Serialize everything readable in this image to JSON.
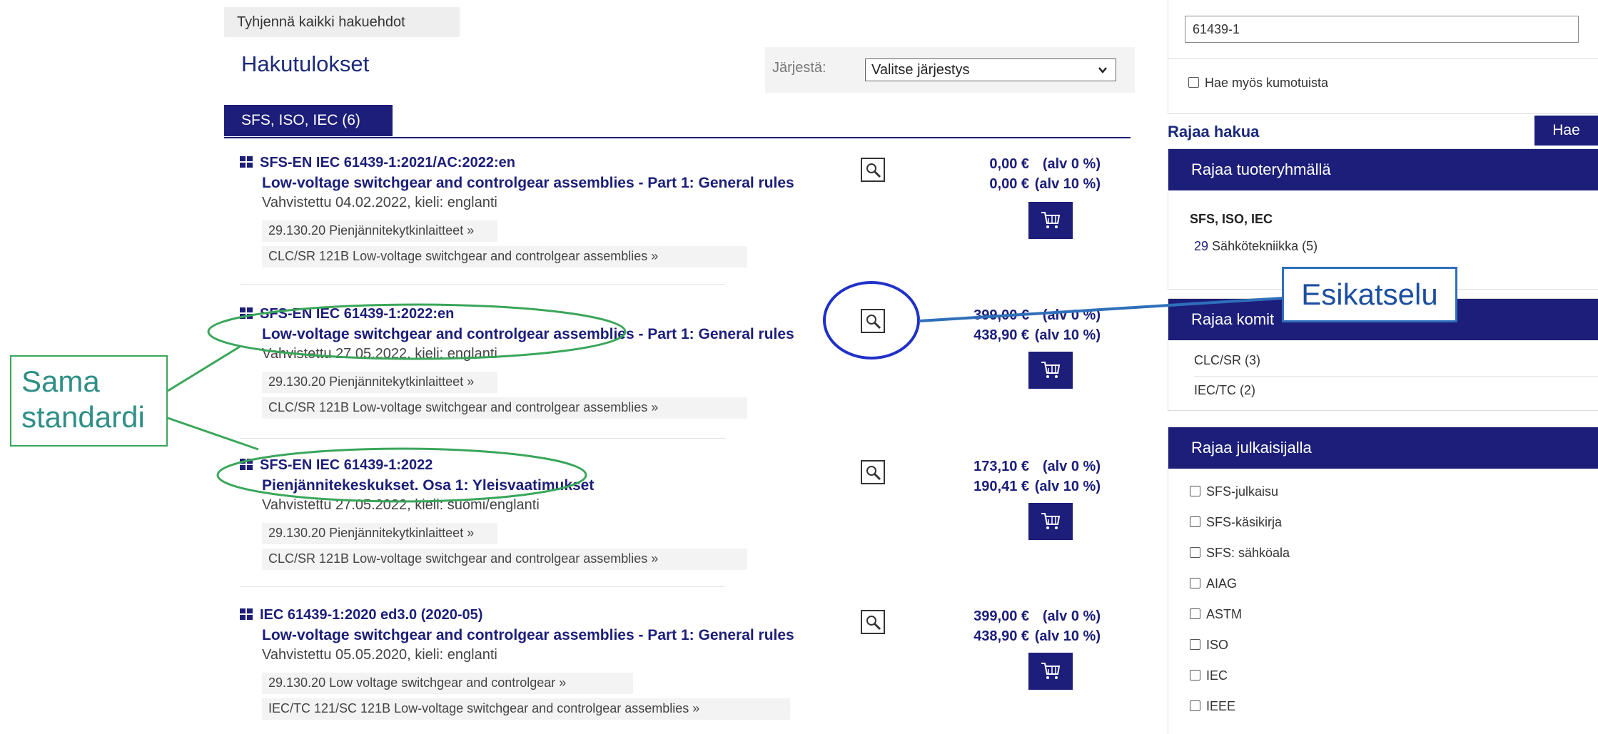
{
  "toolbar": {
    "clear_label": "Tyhjennä kaikki hakuehdot"
  },
  "header": {
    "title": "Hakutulokset",
    "sort_label": "Järjestä:",
    "sort_value": "Valitse järjestys"
  },
  "tabs": [
    {
      "label": "SFS, ISO, IEC (6)"
    }
  ],
  "results": [
    {
      "code": "SFS-EN IEC 61439-1:2021/AC:2022:en",
      "title": "Low-voltage switchgear and controlgear assemblies - Part 1: General rules",
      "date": "Vahvistettu 04.02.2022, kieli: englanti",
      "cat1": "29.130.20 Pienjännitekytkinlaitteet »",
      "cat2": "CLC/SR 121B Low-voltage switchgear and controlgear assemblies »",
      "price1": "0,00 €",
      "vat1": "(alv 0 %)",
      "price2": "0,00 €",
      "vat2": "(alv 10 %)"
    },
    {
      "code": "SFS-EN IEC 61439-1:2022:en",
      "title": "Low-voltage switchgear and controlgear assemblies - Part 1: General rules",
      "date": "Vahvistettu 27.05.2022, kieli: englanti",
      "cat1": "29.130.20 Pienjännitekytkinlaitteet »",
      "cat2": "CLC/SR 121B Low-voltage switchgear and controlgear assemblies »",
      "price1": "399,00 €",
      "vat1": "(alv 0 %)",
      "price2": "438,90 €",
      "vat2": "(alv 10 %)"
    },
    {
      "code": "SFS-EN IEC 61439-1:2022",
      "title": "Pienjännitekeskukset. Osa 1: Yleisvaatimukset",
      "date": "Vahvistettu 27.05.2022, kieli: suomi/englanti",
      "cat1": "29.130.20 Pienjännitekytkinlaitteet »",
      "cat2": "CLC/SR 121B Low-voltage switchgear and controlgear assemblies »",
      "price1": "173,10 €",
      "vat1": "(alv 0 %)",
      "price2": "190,41 €",
      "vat2": "(alv 10 %)"
    },
    {
      "code": "IEC 61439-1:2020 ed3.0 (2020-05)",
      "title": "Low-voltage switchgear and controlgear assemblies - Part 1: General rules",
      "date": "Vahvistettu 05.05.2020, kieli: englanti",
      "cat1": "29.130.20 Low voltage switchgear and controlgear »",
      "cat2": "IEC/TC 121/SC 121B Low-voltage switchgear and controlgear assemblies »",
      "price1": "399,00 €",
      "vat1": "(alv 0 %)",
      "price2": "438,90 €",
      "vat2": "(alv 10 %)"
    }
  ],
  "sidebar": {
    "search_value": "61439-1",
    "also_removed": "Hae myös kumotuista",
    "refine_label": "Rajaa hakua",
    "search_button": "Hae",
    "group_panel": {
      "title": "Rajaa tuoteryhmällä",
      "group": "SFS, ISO, IEC",
      "item_num": "29",
      "item_text": "Sähkötekniikka (5)"
    },
    "committee_panel": {
      "title": "Rajaa komit",
      "items": [
        "CLC/SR (3)",
        "IEC/TC (2)"
      ]
    },
    "publisher_panel": {
      "title": "Rajaa julkaisijalla",
      "items": [
        "SFS-julkaisu",
        "SFS-käsikirja",
        "SFS: sähköala",
        "AIAG",
        "ASTM",
        "ISO",
        "IEC",
        "IEEE"
      ]
    }
  },
  "annotations": {
    "same_standard_line1": "Sama",
    "same_standard_line2": "standardi",
    "preview_label": "Esikatselu",
    "highlight_color": "#3aa65a",
    "preview_color": "#2030c8"
  },
  "colors": {
    "brand": "#1c1e7a"
  }
}
